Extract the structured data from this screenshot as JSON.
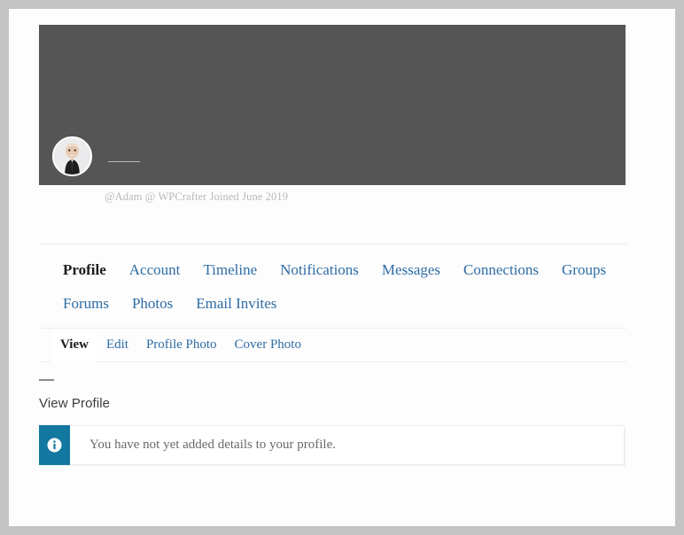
{
  "cover": {
    "background_color": "#555555",
    "avatar_name": "user-avatar",
    "name_placeholder": true
  },
  "profile": {
    "meta_line": "@Adam @ WPCrafter Joined June 2019"
  },
  "nav_primary": {
    "items": [
      {
        "label": "Profile",
        "active": true
      },
      {
        "label": "Account",
        "active": false
      },
      {
        "label": "Timeline",
        "active": false
      },
      {
        "label": "Notifications",
        "active": false
      },
      {
        "label": "Messages",
        "active": false
      },
      {
        "label": "Connections",
        "active": false
      },
      {
        "label": "Groups",
        "active": false
      },
      {
        "label": "Forums",
        "active": false
      },
      {
        "label": "Photos",
        "active": false
      },
      {
        "label": "Email Invites",
        "active": false
      }
    ]
  },
  "nav_sub": {
    "items": [
      {
        "label": "View",
        "active": true
      },
      {
        "label": "Edit",
        "active": false
      },
      {
        "label": "Profile Photo",
        "active": false
      },
      {
        "label": "Cover Photo",
        "active": false
      }
    ]
  },
  "content": {
    "section_title": "View Profile",
    "notice": {
      "icon": "info-icon",
      "message": "You have not yet added details to your profile.",
      "accent_color": "#1278a0"
    }
  },
  "theme": {
    "link_color": "#2e6da4",
    "active_color": "#1c1c1c",
    "cover_color": "#555555",
    "notice_accent": "#1278a0",
    "meta_color": "#b9b9b9",
    "border_color": "#ececec",
    "frame_color": "#c3c3c3"
  }
}
